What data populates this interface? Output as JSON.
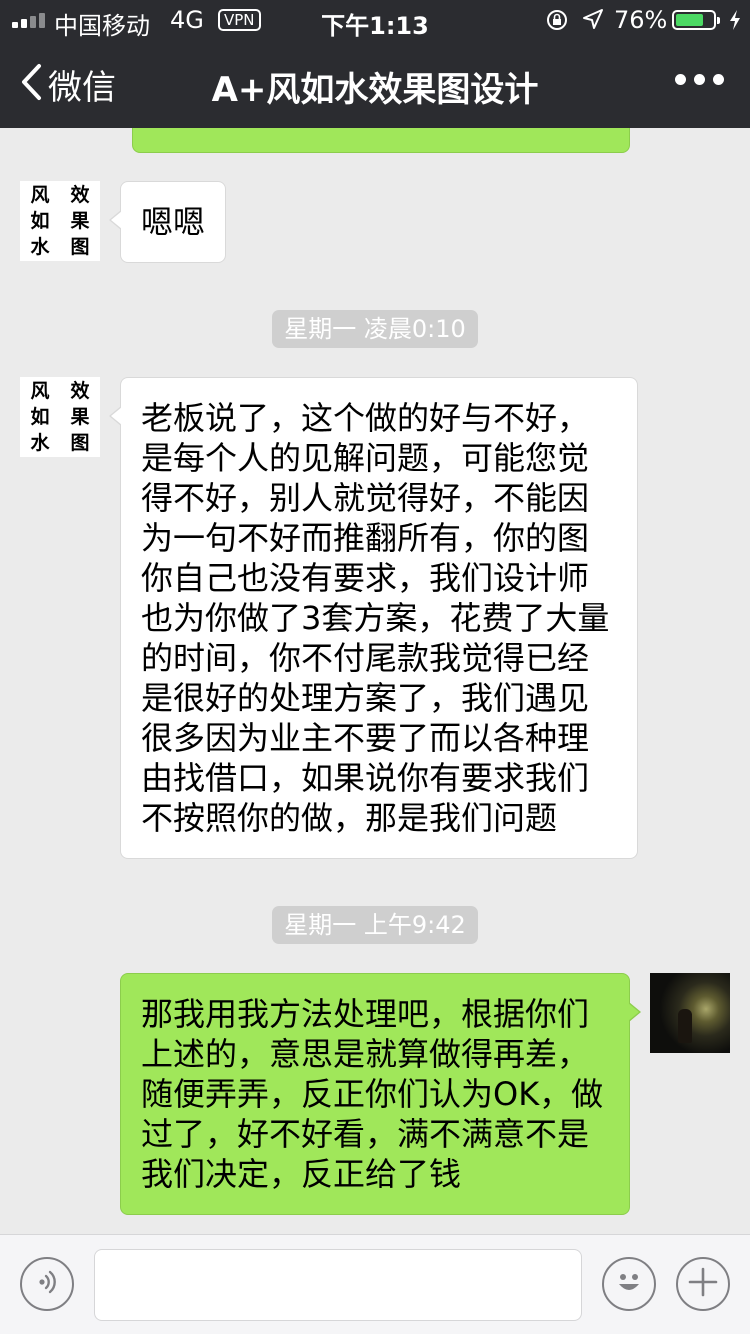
{
  "status_bar": {
    "carrier": "中国移动",
    "network": "4G",
    "vpn": "VPN",
    "time": "下午1:13",
    "battery_percent": "76%",
    "battery_level": 0.76,
    "icons": [
      "signal-icon",
      "lock-rotation-icon",
      "location-icon",
      "battery-icon",
      "charging-icon"
    ]
  },
  "nav": {
    "back_label": "微信",
    "title": "A+风如水效果图设计",
    "more_icon": "more-icon"
  },
  "avatar_brand": [
    "风",
    "效",
    "如",
    "果",
    "水",
    "图"
  ],
  "messages": [
    {
      "side": "left",
      "text": "嗯嗯"
    },
    {
      "timestamp": "星期一 凌晨0:10"
    },
    {
      "side": "left",
      "lines": [
        "老板说了，这个做的好与不好，",
        "是每个人的见解问题，可能您觉",
        "得不好，别人就觉得好，不能因",
        "为一句不好而推翻所有，你的图",
        "你自己也没有要求，我们设计师",
        "也为你做了3套方案，花费了大量",
        "的时间，你不付尾款我觉得已经",
        "是很好的处理方案了，我们遇见",
        "很多因为业主不要了而以各种理",
        "由找借口，如果说你有要求我们",
        "不按照你的做，那是我们问题"
      ]
    },
    {
      "timestamp": "星期一 上午9:42"
    },
    {
      "side": "right",
      "lines": [
        "那我用我方法处理吧，根据你们",
        "上述的，意思是就算做得再差，",
        "随便弄弄，反正你们认为OK，做",
        "过了，好不好看，满不满意不是",
        "我们决定，反正给了钱"
      ]
    }
  ],
  "colors": {
    "header_bg": "#2b2c30",
    "chat_bg": "#ebebeb",
    "sent_bubble": "#a0e75a",
    "received_bubble": "#ffffff",
    "timestamp_bg": "#cfcfcf"
  },
  "input_bar": {
    "voice_icon": "voice-icon",
    "emoji_icon": "emoji-icon",
    "plus_icon": "plus-icon",
    "text_value": ""
  }
}
